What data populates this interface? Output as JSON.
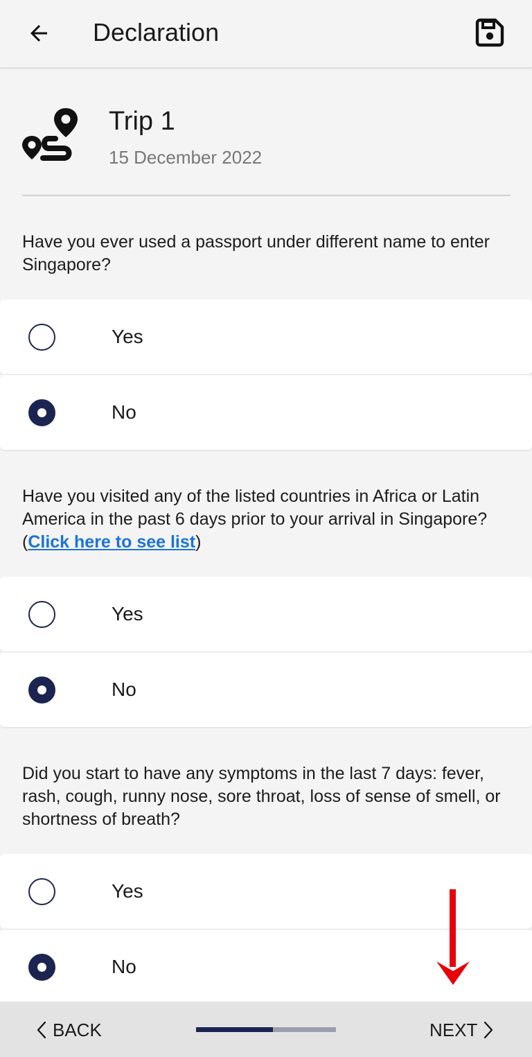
{
  "header": {
    "title": "Declaration",
    "back_icon": "arrow-left-icon",
    "save_icon": "save-icon"
  },
  "trip": {
    "icon": "route-icon",
    "name": "Trip 1",
    "date": "15 December 2022"
  },
  "questions": [
    {
      "text": "Have you ever used a passport under different name to enter Singapore?",
      "options": [
        {
          "label": "Yes",
          "selected": false
        },
        {
          "label": "No",
          "selected": true
        }
      ]
    },
    {
      "text_before": "Have you visited any of the listed countries in Africa or Latin America in the past 6 days prior to your arrival in Singapore? (",
      "link": "Click here to see list",
      "text_after": ")",
      "options": [
        {
          "label": "Yes",
          "selected": false
        },
        {
          "label": "No",
          "selected": true
        }
      ]
    },
    {
      "text": "Did you start to have any symptoms in the last 7 days: fever, rash, cough, runny nose, sore throat, loss of sense of smell, or shortness of breath?",
      "options": [
        {
          "label": "Yes",
          "selected": false
        },
        {
          "label": "No",
          "selected": true
        }
      ]
    }
  ],
  "footer": {
    "back_label": "BACK",
    "next_label": "NEXT",
    "progress": 0.55
  },
  "colors": {
    "primary": "#1c2552",
    "link": "#1a73d9",
    "annotation": "#e8000b",
    "background": "#f4f4f4"
  }
}
